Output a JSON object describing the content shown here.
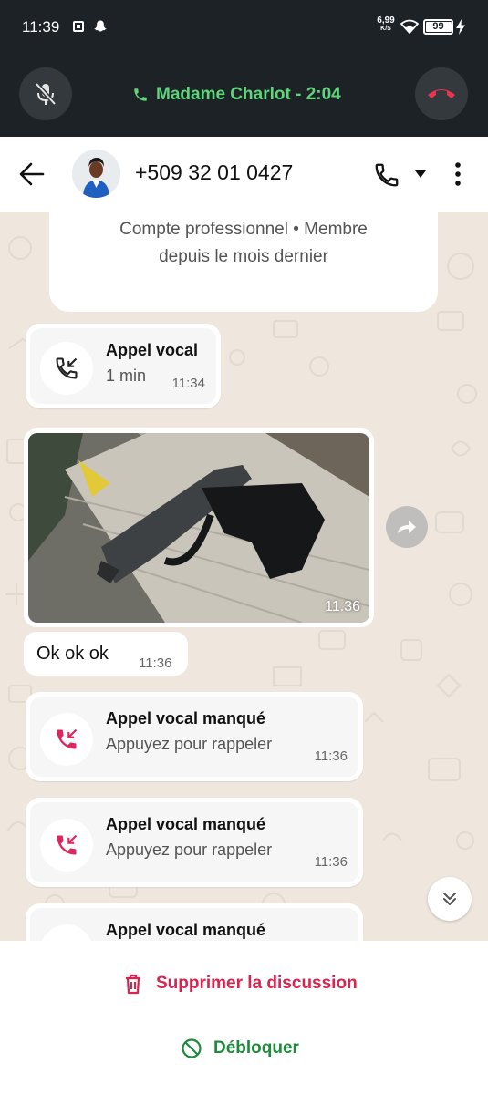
{
  "status_bar": {
    "time": "11:39",
    "net_speed_value": "6,99",
    "net_speed_unit": "K/S",
    "battery_level": "99"
  },
  "call_bar": {
    "caller_text": "Madame Charlot - 2:04",
    "accent_color": "#5ed57a",
    "hangup_color": "#e8364e"
  },
  "header": {
    "contact": "+509 32 01 0427"
  },
  "chat": {
    "info_line1": "Compte professionnel • Membre",
    "info_line2": "depuis le mois dernier",
    "messages": [
      {
        "type": "call",
        "title": "Appel vocal",
        "subtitle": "1 min",
        "time": "11:34",
        "icon": "incoming-call-icon"
      },
      {
        "type": "image",
        "time": "11:36"
      },
      {
        "type": "text",
        "text": "Ok ok ok",
        "time": "11:36"
      },
      {
        "type": "call",
        "title": "Appel vocal manqué",
        "subtitle": "Appuyez pour rappeler",
        "time": "11:36",
        "icon": "missed-call-icon"
      },
      {
        "type": "call",
        "title": "Appel vocal manqué",
        "subtitle": "Appuyez pour rappeler",
        "time": "11:36",
        "icon": "missed-call-icon"
      },
      {
        "type": "call",
        "title": "Appel vocal manqué",
        "icon": "missed-call-icon"
      }
    ]
  },
  "actions": {
    "delete_label": "Supprimer la discussion",
    "unblock_label": "Débloquer",
    "delete_color": "#d6244f",
    "unblock_color": "#1e8a3a"
  }
}
